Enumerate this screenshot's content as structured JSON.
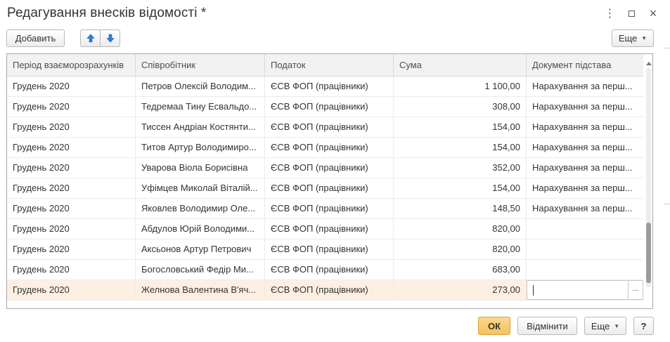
{
  "window": {
    "title": "Редагування внесків відомості *",
    "controls": {
      "more": "⋮",
      "close": "×"
    }
  },
  "toolbar": {
    "add_label": "Добавить",
    "up_icon": "arrow-up-icon",
    "down_icon": "arrow-down-icon",
    "more_label": "Еще",
    "colors": {
      "arrow": "#2f7fd8"
    }
  },
  "table": {
    "columns": [
      "Період взаєморозрахунків",
      "Співробітник",
      "Податок",
      "Сума",
      "Документ підстава"
    ],
    "rows": [
      {
        "period": "Грудень 2020",
        "employee": "Петров Олексій Володим...",
        "tax": "ЄСВ ФОП (працівники)",
        "amount": "1 100,00",
        "doc": "Нарахування за перш..."
      },
      {
        "period": "Грудень 2020",
        "employee": "Тедремаа Тину Есвальдо...",
        "tax": "ЄСВ ФОП (працівники)",
        "amount": "308,00",
        "doc": "Нарахування за перш..."
      },
      {
        "period": "Грудень 2020",
        "employee": "Тиссен Андріан Костянти...",
        "tax": "ЄСВ ФОП (працівники)",
        "amount": "154,00",
        "doc": "Нарахування за перш..."
      },
      {
        "period": "Грудень 2020",
        "employee": "Титов Артур Володимиро...",
        "tax": "ЄСВ ФОП (працівники)",
        "amount": "154,00",
        "doc": "Нарахування за перш..."
      },
      {
        "period": "Грудень 2020",
        "employee": "Уварова Віола Борисівна",
        "tax": "ЄСВ ФОП (працівники)",
        "amount": "352,00",
        "doc": "Нарахування за перш..."
      },
      {
        "period": "Грудень 2020",
        "employee": "Уфімцев Миколай Віталій...",
        "tax": "ЄСВ ФОП (працівники)",
        "amount": "154,00",
        "doc": "Нарахування за перш..."
      },
      {
        "period": "Грудень 2020",
        "employee": "Яковлев Володимир Оле...",
        "tax": "ЄСВ ФОП (працівники)",
        "amount": "148,50",
        "doc": "Нарахування за перш..."
      },
      {
        "period": "Грудень 2020",
        "employee": "Абдулов Юрій Володими...",
        "tax": "ЄСВ ФОП (працівники)",
        "amount": "820,00",
        "doc": ""
      },
      {
        "period": "Грудень 2020",
        "employee": "Аксьонов Артур Петрович",
        "tax": "ЄСВ ФОП (працівники)",
        "amount": "820,00",
        "doc": ""
      },
      {
        "period": "Грудень 2020",
        "employee": "Богословський Федір Ми...",
        "tax": "ЄСВ ФОП (працівники)",
        "amount": "683,00",
        "doc": ""
      },
      {
        "period": "Грудень 2020",
        "employee": "Желнова Валентина В'яч...",
        "tax": "ЄСВ ФОП (працівники)",
        "amount": "273,00",
        "doc": ""
      }
    ],
    "selected_row": 10,
    "edit_button": "..."
  },
  "footer": {
    "ok_label": "ОК",
    "cancel_label": "Відмінити",
    "more_label": "Еще",
    "help_label": "?"
  }
}
